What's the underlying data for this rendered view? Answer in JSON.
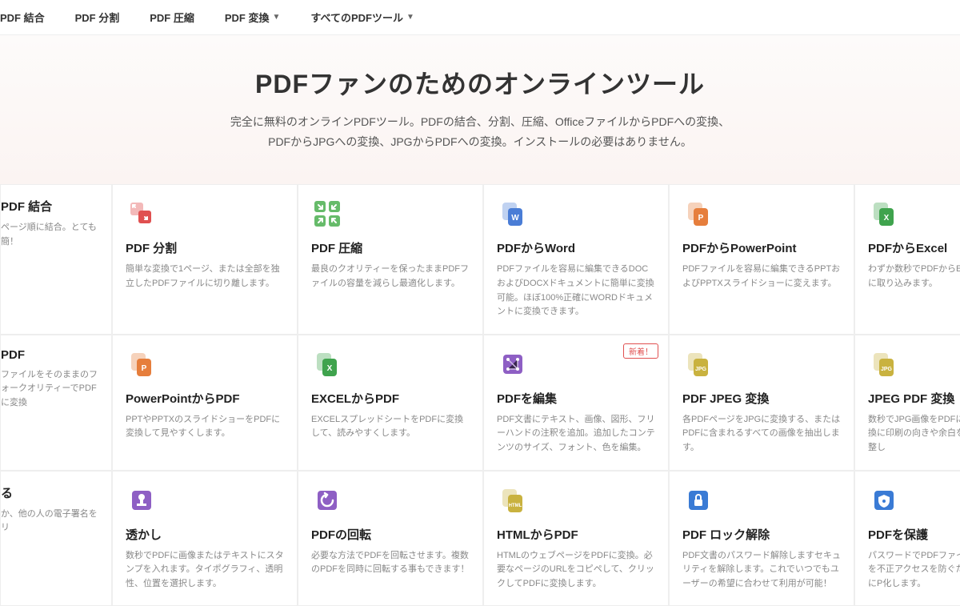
{
  "nav": {
    "items": [
      {
        "label": "PDF 結合",
        "dropdown": false
      },
      {
        "label": "PDF 分割",
        "dropdown": false
      },
      {
        "label": "PDF 圧縮",
        "dropdown": false
      },
      {
        "label": "PDF 変換",
        "dropdown": true
      },
      {
        "label": "すべてのPDFツール",
        "dropdown": true
      }
    ]
  },
  "hero": {
    "title": "PDFファンのためのオンラインツール",
    "line1": "完全に無料のオンラインPDFツール。PDFの結合、分割、圧縮、OfficeファイルからPDFへの変換、",
    "line2": "PDFからJPGへの変換、JPGからPDFへの変換。インストールの必要はありません。"
  },
  "new_badge": "新着！",
  "cards": [
    [
      {
        "id": "merge",
        "title": "PDF 結合",
        "desc": "ページ順に結合。とても簡！",
        "icon": "merge",
        "color": "#e05050",
        "cut": "left"
      },
      {
        "id": "split",
        "title": "PDF 分割",
        "desc": "簡単な変換で1ページ、または全部を独立したPDFファイルに切り離します。",
        "icon": "split",
        "color": "#e05050"
      },
      {
        "id": "compress",
        "title": "PDF 圧縮",
        "desc": "最良のクオリティーを保ったままPDFファイルの容量を減らし最適化します。",
        "icon": "compress",
        "color": "#66bb6a"
      },
      {
        "id": "toword",
        "title": "PDFからWord",
        "desc": "PDFファイルを容易に編集できるDOCおよびDOCXドキュメントに簡単に変換可能。ほぼ100%正確にWORDドキュメントに変換できます。",
        "icon": "word",
        "color": "#4a7dd6"
      },
      {
        "id": "toppt",
        "title": "PDFからPowerPoint",
        "desc": "PDFファイルを容易に編集できるPPTおよびPPTXスライドショーに変えます。",
        "icon": "ppt",
        "color": "#e67e3c"
      },
      {
        "id": "toexcel",
        "title": "PDFからExcel",
        "desc": "わずか数秒でPDFからExcelに取り込みます。",
        "icon": "excel",
        "color": "#3fa34d",
        "cut": "right"
      }
    ],
    [
      {
        "id": "wordtopdf",
        "title": "PDF",
        "desc": "ファイルをそのままのフォークオリティーでPDFに変換",
        "icon": "word",
        "color": "#4a7dd6",
        "cut": "left"
      },
      {
        "id": "ppttopdf",
        "title": "PowerPointからPDF",
        "desc": "PPTやPPTXのスライドショーをPDFに変換して見やすくします。",
        "icon": "ppt2",
        "color": "#e67e3c"
      },
      {
        "id": "exceltopdf",
        "title": "EXCELからPDF",
        "desc": "EXCELスプレッドシートをPDFに変換して、読みやすくします。",
        "icon": "excel2",
        "color": "#3fa34d"
      },
      {
        "id": "edit",
        "title": "PDFを編集",
        "desc": "PDF文書にテキスト、画像、図形、フリーハンドの注釈を追加。追加したコンテンツのサイズ、フォント、色を編集。",
        "icon": "edit",
        "color": "#8e5fc4",
        "new": true
      },
      {
        "id": "tojpg",
        "title": "PDF JPEG 変換",
        "desc": "各PDFページをJPGに変換する、またはPDFに含まれるすべての画像を抽出します。",
        "icon": "jpg",
        "color": "#c9b23f"
      },
      {
        "id": "jpgtopdf",
        "title": "JPEG PDF 変換",
        "desc": "数秒でJPG画像をPDFに変換に印刷の向きや余白を調整し",
        "icon": "jpg",
        "color": "#c9b23f",
        "cut": "right"
      }
    ],
    [
      {
        "id": "sign",
        "title": "る",
        "desc": "か、他の人の電子署名をリ",
        "icon": "sign",
        "color": "#8e5fc4",
        "cut": "left"
      },
      {
        "id": "watermark",
        "title": "透かし",
        "desc": "数秒でPDFに画像またはテキストにスタンプを入れます。タイポグラフィ、透明性、位置を選択します。",
        "icon": "stamp",
        "color": "#8e5fc4"
      },
      {
        "id": "rotate",
        "title": "PDFの回転",
        "desc": "必要な方法でPDFを回転させます。複数のPDFを同時に回転する事もできます！",
        "icon": "rotate",
        "color": "#8e5fc4"
      },
      {
        "id": "htmltopdf",
        "title": "HTMLからPDF",
        "desc": "HTMLのウェブページをPDFに変換。必要なページのURLをコピペして、クリックしてPDFに変換します。",
        "icon": "html",
        "color": "#c9b23f"
      },
      {
        "id": "unlock",
        "title": "PDF ロック解除",
        "desc": "PDF文書のパスワード解除しますセキュリティを解除します。これでいつでもユーザーの希望に合わせて利用が可能！",
        "icon": "unlock",
        "color": "#3a7bd5"
      },
      {
        "id": "protect",
        "title": "PDFを保護",
        "desc": "パスワードでPDFファイルを不正アクセスを防ぐためにP化します。",
        "icon": "protect",
        "color": "#3a7bd5",
        "cut": "right"
      }
    ]
  ],
  "icons": {
    "merge": "#e05050",
    "split": "#e05050",
    "compress": "#66bb6a",
    "word": "#4a7dd6",
    "ppt": "#e67e3c",
    "excel": "#3fa34d",
    "edit": "#8e5fc4",
    "jpg": "#c9b23f",
    "stamp": "#8e5fc4",
    "rotate": "#8e5fc4",
    "html": "#c9b23f",
    "unlock": "#3a7bd5",
    "protect": "#3a7bd5",
    "sign": "#8e5fc4"
  }
}
